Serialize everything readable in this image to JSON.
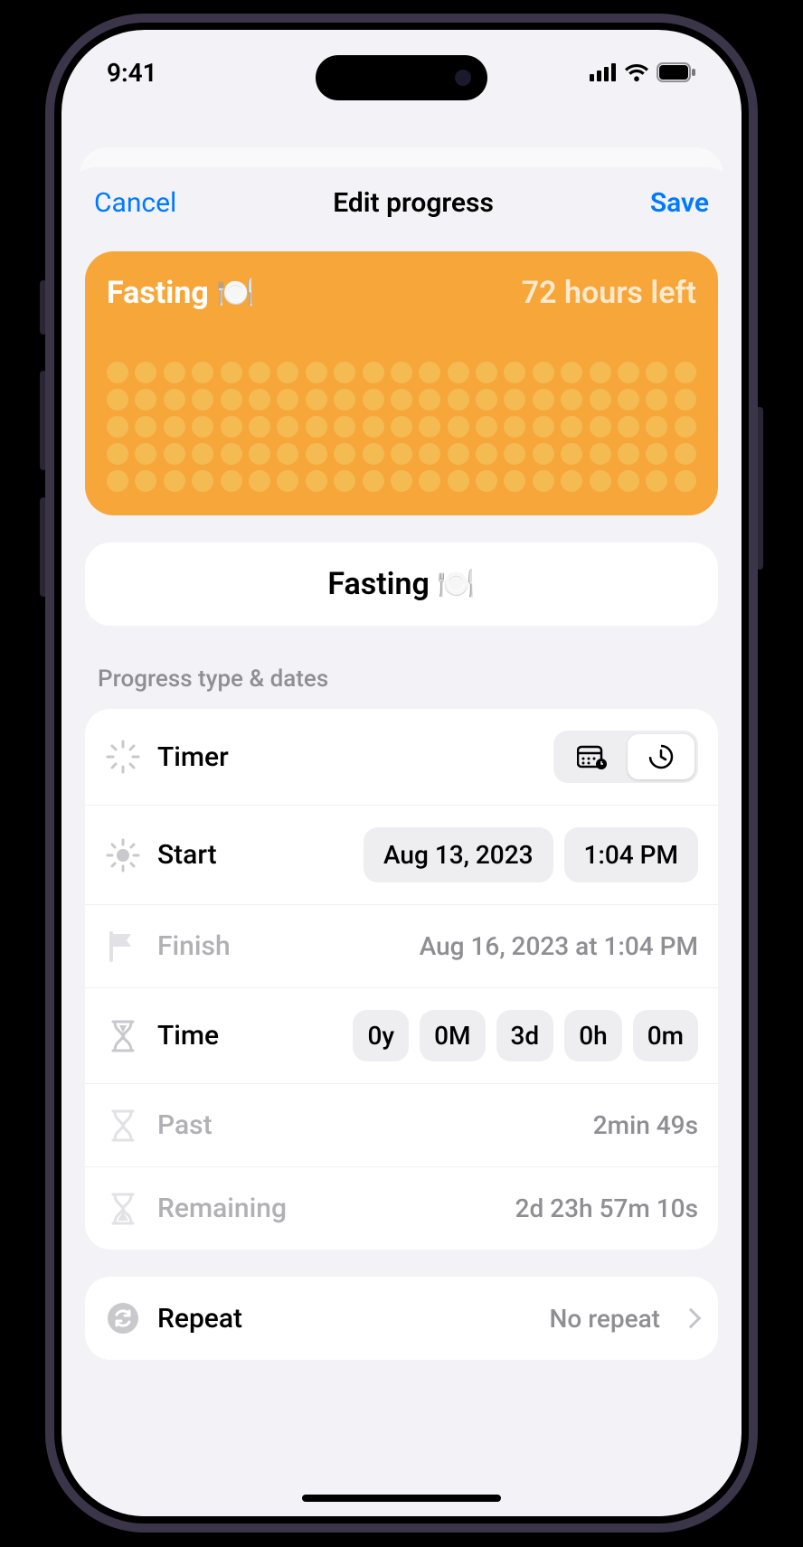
{
  "status": {
    "time": "9:41"
  },
  "nav": {
    "cancel": "Cancel",
    "title": "Edit progress",
    "save": "Save"
  },
  "hero": {
    "title": "Fasting 🍽️",
    "subtitle": "72 hours left"
  },
  "name_card": {
    "value": "Fasting 🍽️"
  },
  "section_label": "Progress type & dates",
  "rows": {
    "timer": {
      "label": "Timer"
    },
    "start": {
      "label": "Start",
      "date": "Aug 13, 2023",
      "time": "1:04 PM"
    },
    "finish": {
      "label": "Finish",
      "value": "Aug 16, 2023 at 1:04 PM"
    },
    "time": {
      "label": "Time",
      "y": "0y",
      "M": "0M",
      "d": "3d",
      "h": "0h",
      "m": "0m"
    },
    "past": {
      "label": "Past",
      "value": "2min 49s"
    },
    "remaining": {
      "label": "Remaining",
      "value": "2d 23h 57m 10s"
    },
    "repeat": {
      "label": "Repeat",
      "value": "No repeat"
    }
  }
}
